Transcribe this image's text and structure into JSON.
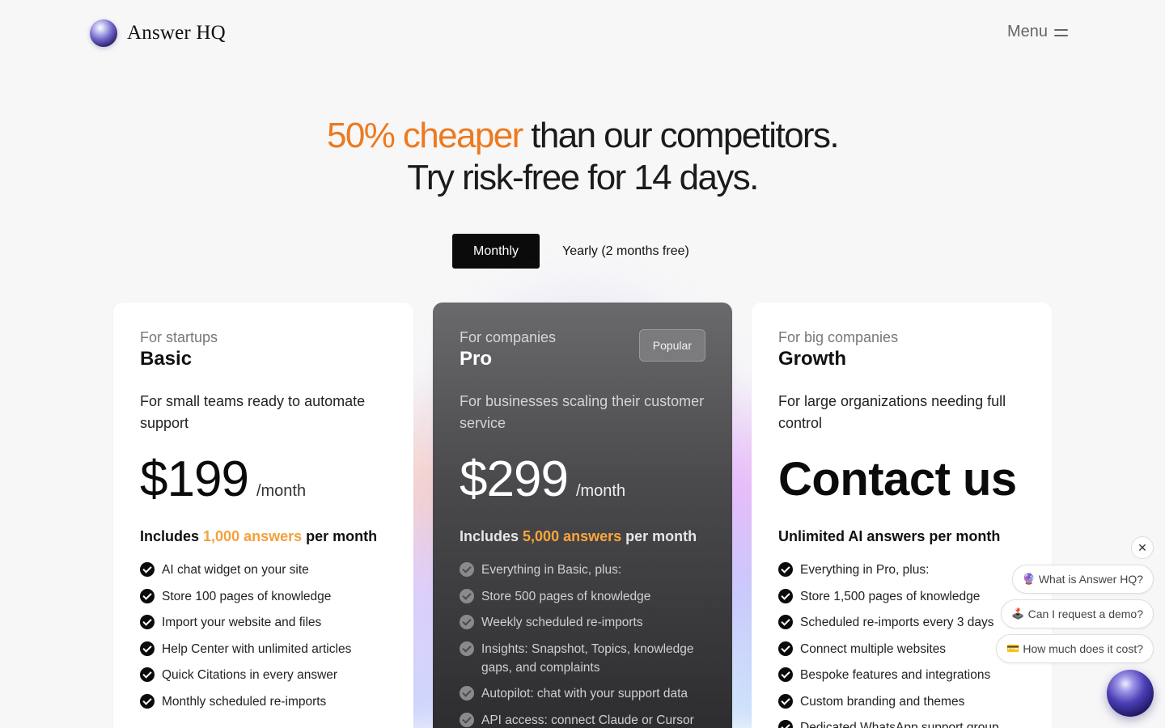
{
  "header": {
    "logo_text": "Answer HQ",
    "menu_label": "Menu"
  },
  "headline": {
    "accent": "50% cheaper",
    "rest_line1": " than our competitors.",
    "line2": "Try risk-free for 14 days."
  },
  "billing_toggle": {
    "monthly": "Monthly",
    "yearly": "Yearly (2 months free)",
    "selected": "Monthly"
  },
  "plans": [
    {
      "audience": "For startups",
      "name": "Basic",
      "description": "For small teams ready to automate support",
      "price": "$199",
      "period": "/month",
      "includes_prefix": "Includes ",
      "includes_highlight": "1,000 answers",
      "includes_suffix": " per month",
      "features": [
        "AI chat widget on your site",
        "Store 100 pages of knowledge",
        "Import your website and files",
        "Help Center with unlimited articles",
        "Quick Citations in every answer",
        "Monthly scheduled re-imports"
      ]
    },
    {
      "audience": "For companies",
      "name": "Pro",
      "badge": "Popular",
      "description": "For businesses scaling their customer service",
      "price": "$299",
      "period": "/month",
      "includes_prefix": "Includes ",
      "includes_highlight": "5,000 answers",
      "includes_suffix": " per month",
      "features": [
        "Everything in Basic, plus:",
        "Store 500 pages of knowledge",
        "Weekly scheduled re-imports",
        "Insights: Snapshot, Topics, knowledge gaps, and complaints",
        "Autopilot: chat with your support data",
        "API access: connect Claude or Cursor"
      ]
    },
    {
      "audience": "For big companies",
      "name": "Growth",
      "description": "For large organizations needing full control",
      "price": "Contact us",
      "includes_text": "Unlimited AI answers per month",
      "features": [
        "Everything in Pro, plus:",
        "Store 1,500 pages of knowledge",
        "Scheduled re-imports every 3 days",
        "Connect multiple websites",
        "Bespoke features and integrations",
        "Custom branding and themes",
        "Dedicated WhatsApp support group"
      ]
    }
  ],
  "chat_widget": {
    "close_label": "✕",
    "suggestions": [
      {
        "emoji": "🔮",
        "text": "What is Answer HQ?"
      },
      {
        "emoji": "🕹️",
        "text": "Can I request a demo?"
      },
      {
        "emoji": "💳",
        "text": "How much does it cost?"
      }
    ]
  },
  "colors": {
    "accent_orange": "#ed7a1f",
    "highlight_orange": "#f5a03c",
    "toggle_active_bg": "#0b0b0b",
    "pro_card_bg": "#4a4a4d"
  },
  "icons": [
    "logo-orb-icon",
    "menu-icon",
    "check-icon",
    "close-icon",
    "chat-orb-icon"
  ]
}
